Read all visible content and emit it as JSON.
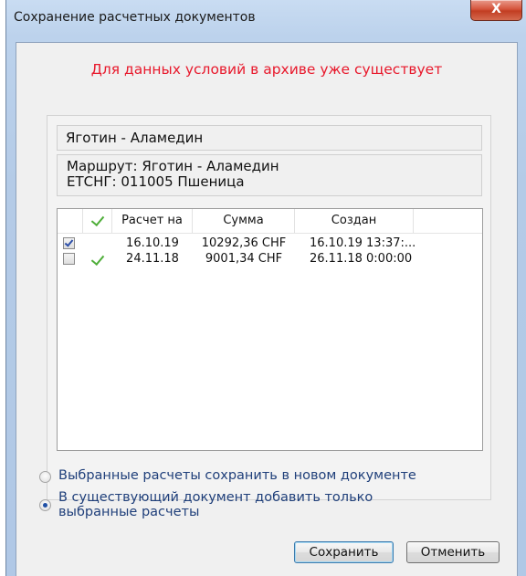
{
  "window": {
    "title": "Сохранение расчетных документов",
    "close_label": "X"
  },
  "warning": "Для данных условий в архиве уже существует",
  "route_name": "Яготин - Аламедин",
  "info": {
    "route_line": "Маршрут: Яготин - Аламедин",
    "cargo_line": "ЕТСНГ: 011005 Пшеница"
  },
  "table": {
    "columns": [
      "",
      "",
      "Расчет на",
      "Сумма",
      "Создан"
    ],
    "rows": [
      {
        "checked": true,
        "saved": false,
        "date": "16.10.19",
        "sum": "10292,36 CHF",
        "created": "16.10.19  13:37:..."
      },
      {
        "checked": false,
        "saved": true,
        "date": "24.11.18",
        "sum": "9001,34 CHF",
        "created": "26.11.18  0:00:00"
      }
    ]
  },
  "options": [
    {
      "line1": "Выбранные расчеты сохранить в новом документе",
      "line2": "",
      "selected": false
    },
    {
      "line1": "В существующий документ добавить только",
      "line2": "выбранные расчеты",
      "selected": true
    }
  ],
  "buttons": {
    "save": "Сохранить",
    "cancel": "Отменить"
  },
  "colors": {
    "warning": "#e8192c",
    "option_text": "#1f3f7a",
    "check_green": "#4fae3a"
  }
}
